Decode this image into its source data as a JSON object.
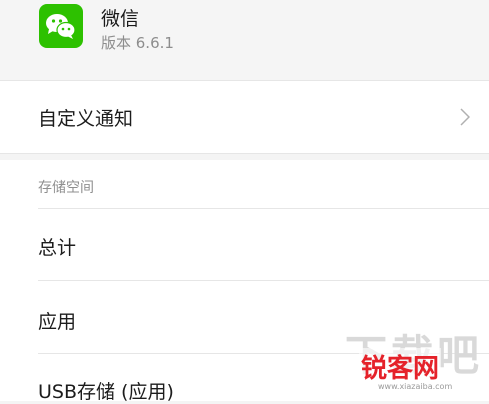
{
  "app": {
    "name": "微信",
    "version": "版本 6.6.1",
    "icon": "wechat-icon",
    "icon_color": "#2dc100"
  },
  "custom_notification": {
    "label": "自定义通知",
    "chevron_icon": "chevron-right-icon"
  },
  "storage": {
    "header": "存储空间",
    "items": [
      {
        "label": "总计"
      },
      {
        "label": "应用"
      },
      {
        "label": "USB存储 (应用)"
      }
    ]
  },
  "watermark": {
    "big_text": "下载吧",
    "brand": "锐客网",
    "url": "www.xiazaiba.com"
  }
}
